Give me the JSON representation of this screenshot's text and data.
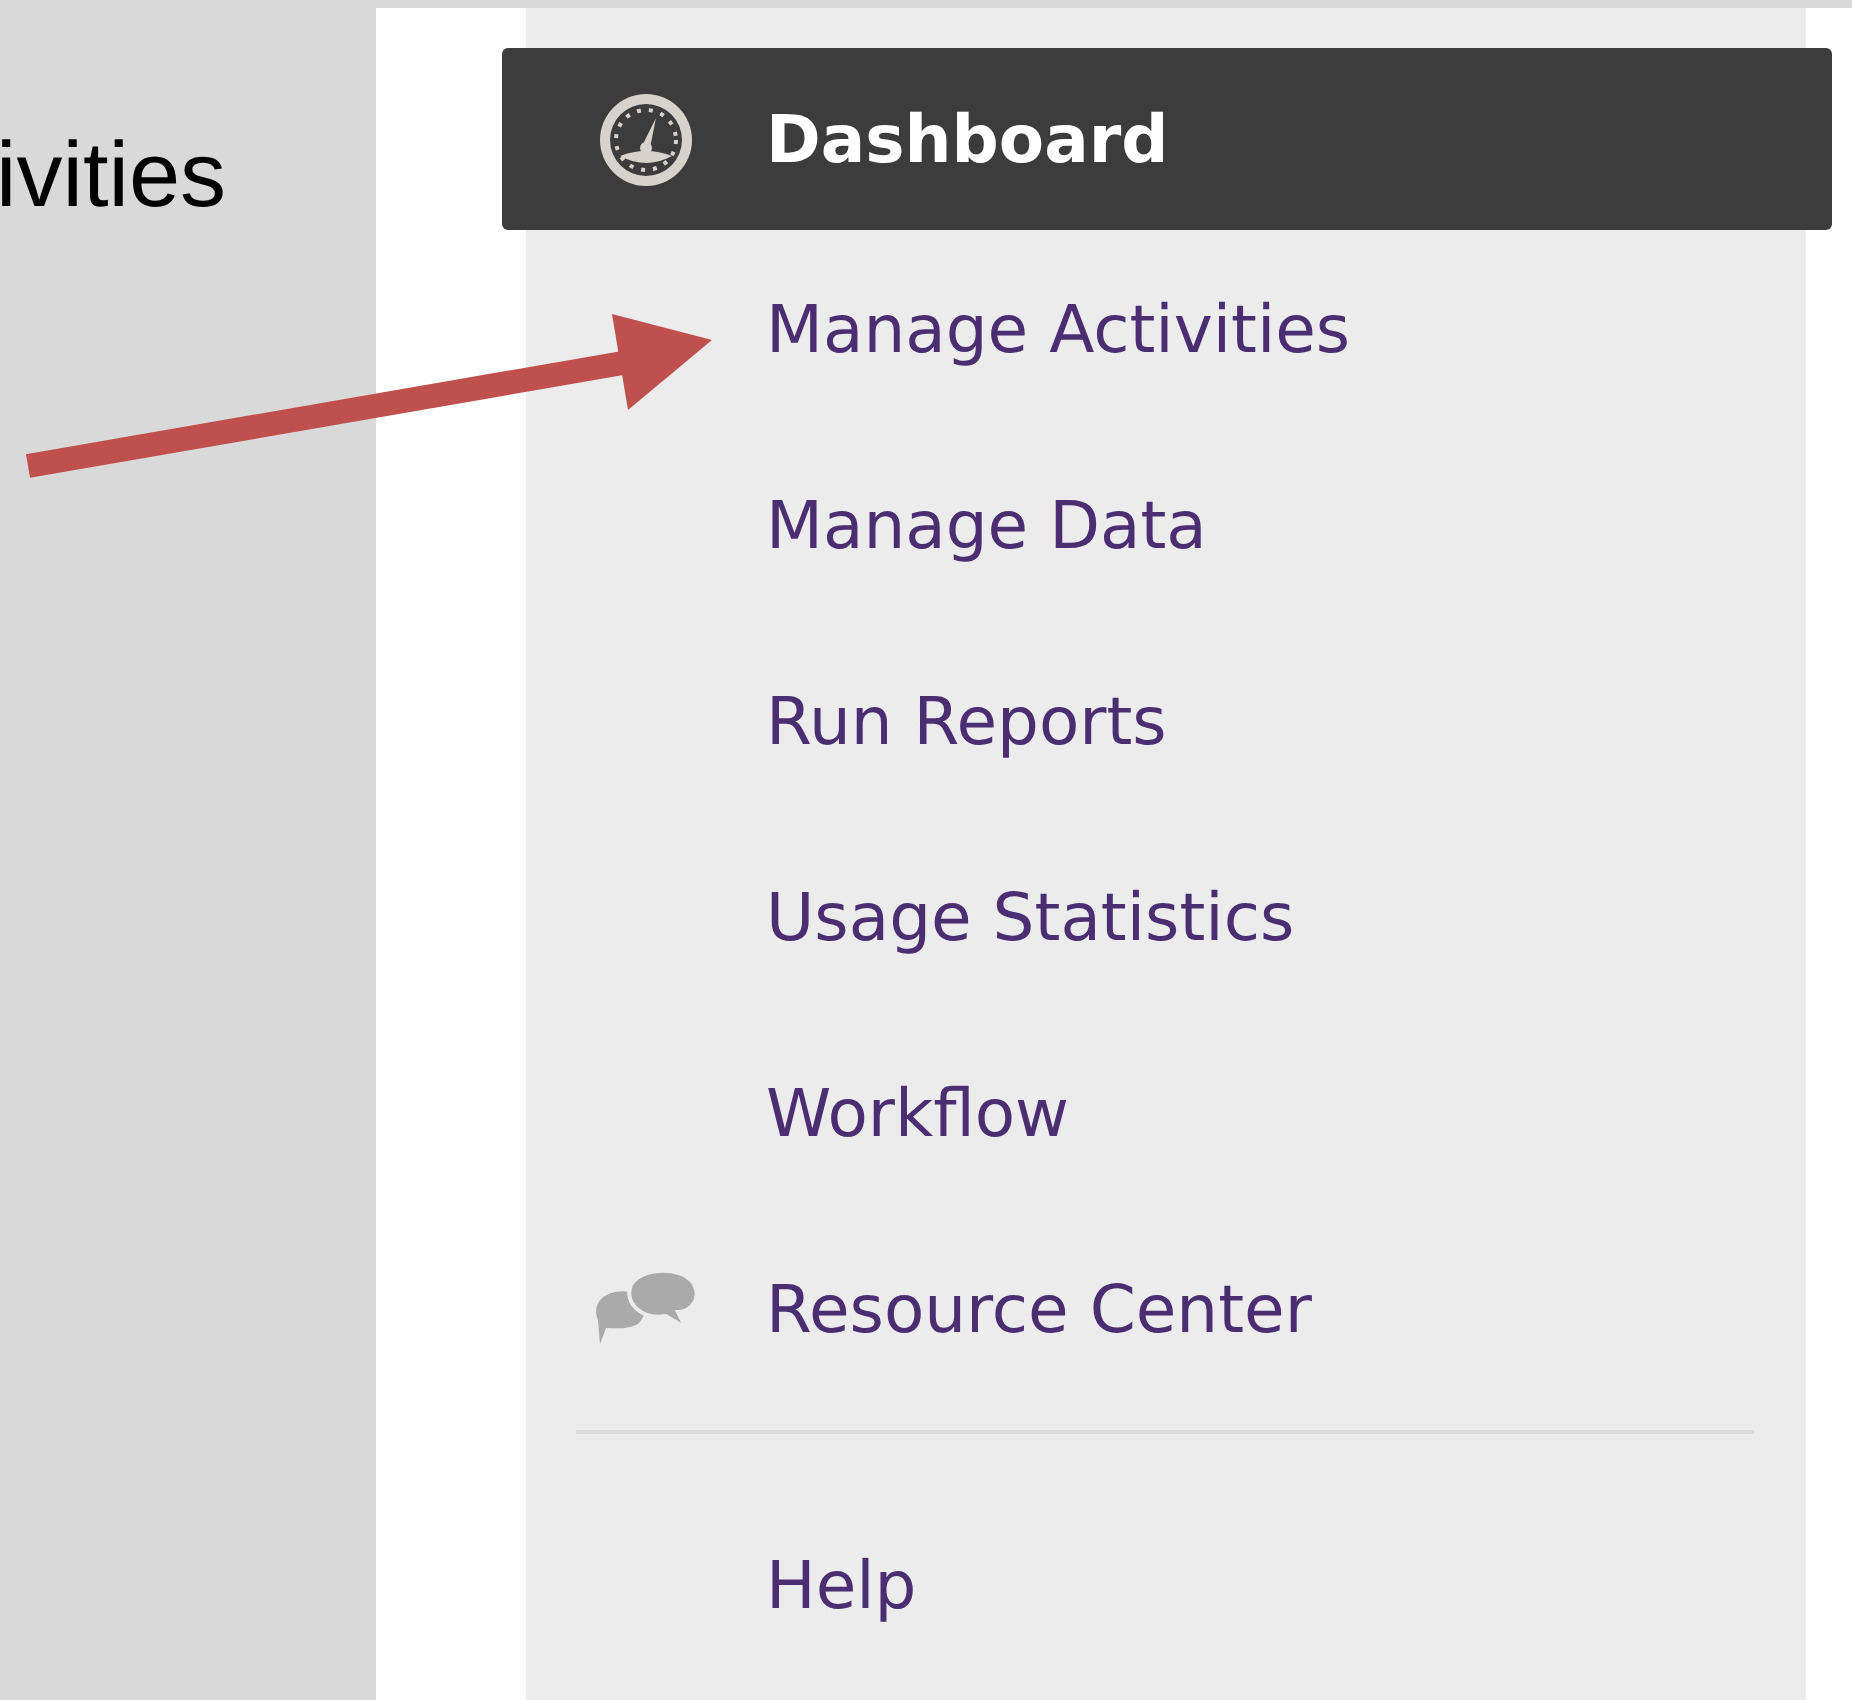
{
  "slide_text": "ivities",
  "menu": {
    "items": [
      {
        "label": "Dashboard",
        "kind": "gauge",
        "selected": true
      },
      {
        "label": "Manage Activities",
        "kind": "plain",
        "selected": false
      },
      {
        "label": "Manage Data",
        "kind": "plain",
        "selected": false
      },
      {
        "label": "Run Reports",
        "kind": "plain",
        "selected": false
      },
      {
        "label": "Usage Statistics",
        "kind": "plain",
        "selected": false
      },
      {
        "label": "Workflow",
        "kind": "plain",
        "selected": false
      },
      {
        "label": "Resource Center",
        "kind": "chat",
        "selected": false
      }
    ],
    "footer_items": [
      {
        "label": "Help",
        "selected": false
      }
    ]
  }
}
